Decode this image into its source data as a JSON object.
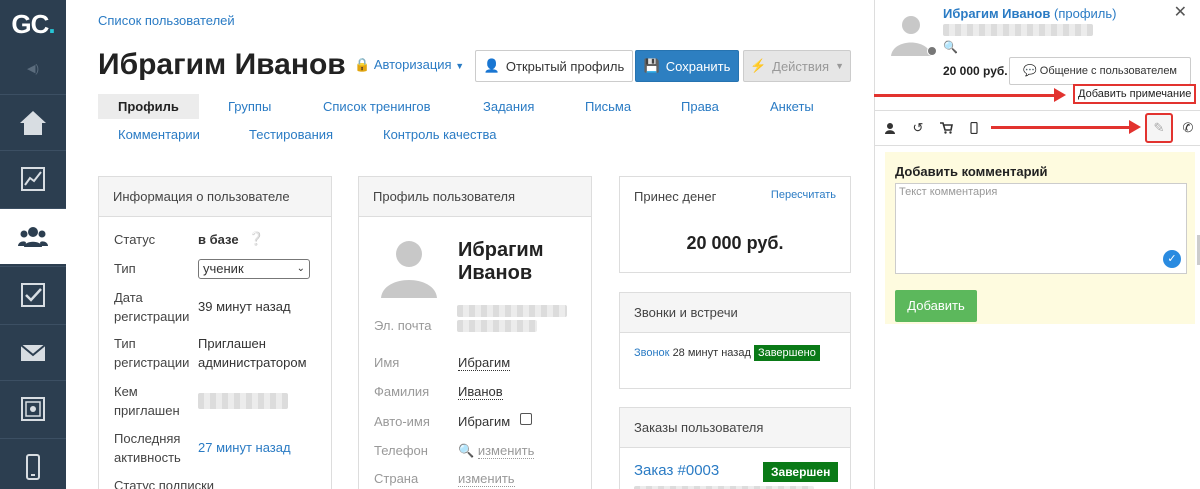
{
  "logo": {
    "text": "GC",
    "dot": "."
  },
  "breadcrumb": "Список пользователей",
  "user": {
    "name": "Ибрагим Иванов",
    "first": "Ибрагим",
    "last": "Иванов",
    "name_line1": "Ибрагим",
    "name_line2": "Иванов"
  },
  "header": {
    "auth_label": "Авторизация",
    "open_profile": "Открытый профиль",
    "save": "Сохранить",
    "actions": "Действия"
  },
  "tabs": [
    "Профиль",
    "Группы",
    "Список тренингов",
    "Задания",
    "Письма",
    "Права",
    "Анкеты",
    "Комментарии",
    "Тестирования",
    "Контроль качества"
  ],
  "info": {
    "title": "Информация о пользователе",
    "status_label": "Статус",
    "status_value": "в базе",
    "type_label": "Тип",
    "type_value": "ученик",
    "reg_date_label_1": "Дата",
    "reg_date_label_2": "регистрации",
    "reg_date_value": "39 минут назад",
    "reg_type_label_1": "Тип",
    "reg_type_label_2": "регистрации",
    "reg_type_value_1": "Приглашен",
    "reg_type_value_2": "администратором",
    "invited_label_1": "Кем",
    "invited_label_2": "приглашен",
    "last_activity_label_1": "Последняя",
    "last_activity_label_2": "активность",
    "last_activity_value": "27 минут назад",
    "sub_status_label": "Статус подписки"
  },
  "profile": {
    "title": "Профиль пользователя",
    "email_label": "Эл. почта",
    "name_label": "Имя",
    "surname_label": "Фамилия",
    "autoname_label": "Авто-имя",
    "autoname_value": "Ибрагим",
    "phone_label": "Телефон",
    "phone_value": "изменить",
    "country_label": "Страна",
    "country_value": "изменить"
  },
  "money": {
    "title": "Принес денег",
    "recalc": "Пересчитать",
    "amount": "20 000 руб."
  },
  "calls": {
    "title": "Звонки и встречи",
    "link": "Звонок",
    "time": "28 минут назад",
    "status": "Завершено"
  },
  "orders": {
    "title": "Заказы пользователя",
    "order": "Заказ #0003",
    "status": "Завершен"
  },
  "right_panel": {
    "user_link": "Ибрагим Иванов",
    "profile_link": "(профиль)",
    "amount": "20 000 руб.",
    "chat_button": "Общение с пользователем",
    "tooltip": "Добавить примечание",
    "comment_title": "Добавить комментарий",
    "comment_placeholder": "Текст комментария",
    "add_button": "Добавить"
  },
  "colors": {
    "sidebar": "#2c3e50",
    "accent": "#2d7fc1",
    "success": "#0a7a17",
    "add": "#5cb85c",
    "annotation": "#e2332f"
  }
}
